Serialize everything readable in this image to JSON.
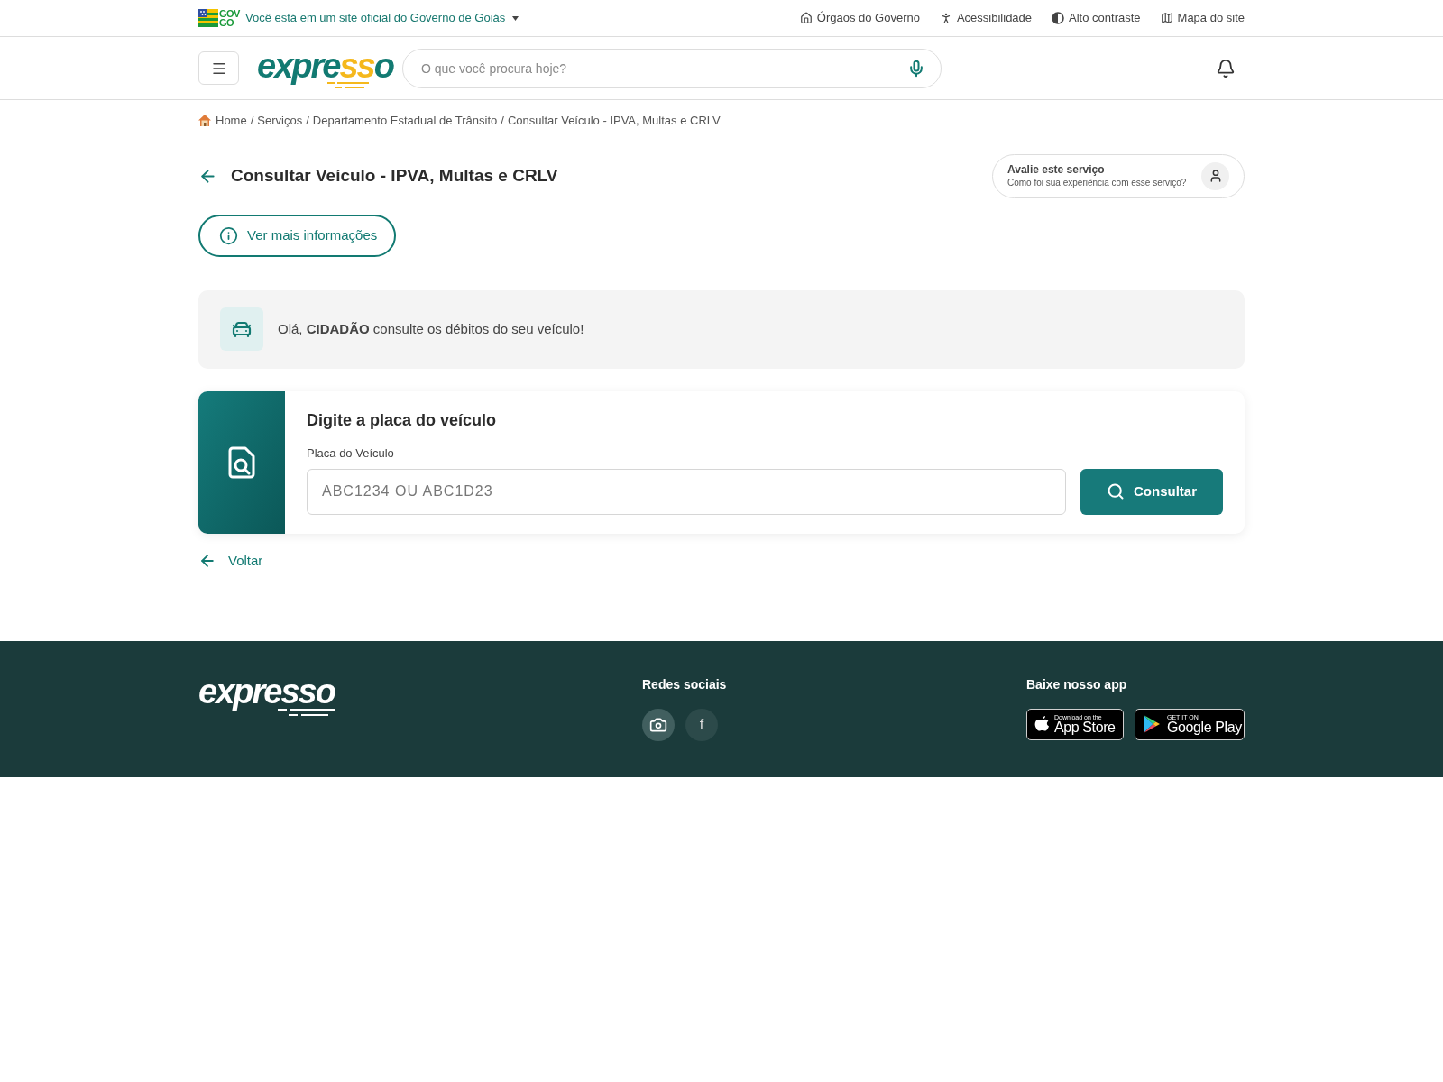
{
  "top_bar": {
    "gov_logo": [
      "GOV",
      "GO"
    ],
    "official_notice": "Você está em um site oficial do Governo de Goiás",
    "links": [
      {
        "label": "Órgãos do Governo",
        "kind": "home"
      },
      {
        "label": "Acessibilidade",
        "kind": "accessibility"
      },
      {
        "label": "Alto contraste",
        "kind": "contrast"
      },
      {
        "label": "Mapa do site",
        "kind": "map"
      }
    ]
  },
  "header": {
    "logo": [
      {
        "text": "expre",
        "accent": false
      },
      {
        "text": "ss",
        "accent": true
      },
      {
        "text": "o",
        "accent": false
      }
    ],
    "search": {
      "placeholder": "O que você procura hoje?"
    }
  },
  "breadcrumb": [
    {
      "label": "Home"
    },
    {
      "separator": "/",
      "label": "Serviços"
    },
    {
      "separator": "/",
      "label": "Departamento Estadual de Trânsito"
    },
    {
      "separator": "/",
      "label": "Consultar Veículo - IPVA, Multas e CRLV"
    }
  ],
  "page": {
    "title": "Consultar Veículo - IPVA, Multas e CRLV",
    "rating": {
      "title": "Avalie este serviço",
      "subtitle": "Como foi sua experiência com esse serviço?"
    },
    "info_button": "Ver mais informações"
  },
  "greeting": "Olá, **CIDADÃO** consulte os débitos do seu veículo!",
  "form": {
    "heading": "Digite a placa do veículo",
    "label": "Placa do Veículo",
    "input": {
      "placeholder": "ABC1234 OU ABC1D23"
    },
    "submit": "Consultar"
  },
  "back_link": "Voltar",
  "footer": {
    "logo": "expresso",
    "social": {
      "title": "Redes sociais",
      "items": [
        {
          "kind": "icon"
        },
        {
          "kind": "text",
          "label": "f"
        }
      ]
    },
    "apps": {
      "title": "Baixe nosso app",
      "badges": [
        {
          "kind": "apple",
          "small": "Download on the",
          "large": "App Store"
        },
        {
          "kind": "google",
          "small": "GET IT ON",
          "large": "Google Play"
        }
      ]
    }
  }
}
